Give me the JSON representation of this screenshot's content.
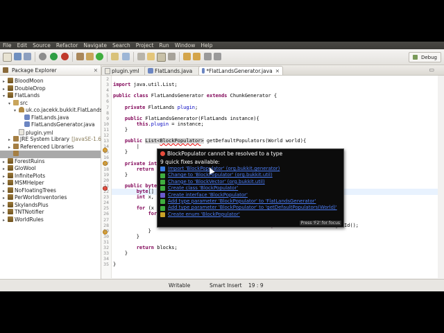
{
  "menu": [
    "File",
    "Edit",
    "Source",
    "Refactor",
    "Navigate",
    "Search",
    "Project",
    "Run",
    "Window",
    "Help"
  ],
  "toolbar": {
    "perspective_label": "Debug"
  },
  "explorer": {
    "tab_label": "Package Explorer",
    "items": [
      {
        "label": "BloodMoon",
        "depth": 0,
        "icon": "project-icon"
      },
      {
        "label": "DoubleDrop",
        "depth": 0,
        "icon": "project-icon"
      },
      {
        "label": "FlatLands",
        "depth": 0,
        "icon": "project-icon"
      },
      {
        "label": "src",
        "depth": 1,
        "icon": "source-folder-icon"
      },
      {
        "label": "uk.co.jacekk.bukkit.FlatLands",
        "depth": 2,
        "icon": "package-icon"
      },
      {
        "label": "FlatLands.java",
        "depth": 3,
        "icon": "java-file-icon"
      },
      {
        "label": "FlatLandsGenerator.java",
        "depth": 3,
        "icon": "java-file-icon"
      },
      {
        "label": "plugin.yml",
        "depth": 2,
        "icon": "yml-file-icon"
      },
      {
        "label": "JRE System Library",
        "decor": "[JavaSE-1.6]",
        "depth": 1,
        "icon": "library-icon"
      },
      {
        "label": "Referenced Libraries",
        "depth": 1,
        "icon": "library-icon"
      },
      {
        "label": "",
        "depth": 1,
        "icon": "jar-icon"
      },
      {
        "label": "ForestRuins",
        "depth": 0,
        "icon": "project-icon"
      },
      {
        "label": "GloWool",
        "depth": 0,
        "icon": "project-icon"
      },
      {
        "label": "InfinitePlots",
        "depth": 0,
        "icon": "project-icon"
      },
      {
        "label": "MSMHelper",
        "depth": 0,
        "icon": "project-icon"
      },
      {
        "label": "NoFloatingTrees",
        "depth": 0,
        "icon": "project-icon"
      },
      {
        "label": "PerWorldInventories",
        "depth": 0,
        "icon": "project-icon"
      },
      {
        "label": "SkylandsPlus",
        "depth": 0,
        "icon": "project-icon"
      },
      {
        "label": "TNTNotifier",
        "depth": 0,
        "icon": "project-icon"
      },
      {
        "label": "WorldRules",
        "depth": 0,
        "icon": "project-icon"
      }
    ]
  },
  "editor": {
    "tabs": [
      "plugin.yml",
      "FlatLands.java",
      "*FlatLandsGenerator.java"
    ],
    "lines": [
      {
        "n": "2",
        "text": ""
      },
      {
        "n": "3",
        "text": "import java.util.List;"
      },
      {
        "n": "4",
        "text": ""
      },
      {
        "n": "5",
        "text": "public class FlatLandsGenerator extends ChunkGenerator {"
      },
      {
        "n": "6",
        "text": ""
      },
      {
        "n": "7",
        "text": "    private FlatLands plugin;"
      },
      {
        "n": "8",
        "text": ""
      },
      {
        "n": "9",
        "text": "    public FlatLandsGenerator(FlatLands instance){"
      },
      {
        "n": "10",
        "text": "        this.plugin = instance;"
      },
      {
        "n": "11",
        "text": "    }"
      },
      {
        "n": "12",
        "text": ""
      },
      {
        "n": "13",
        "text": "    public List<BlockPopulator> getDefaultPopulators(World world){"
      },
      {
        "n": "14",
        "text": "        |"
      },
      {
        "n": "15",
        "text": "    }"
      },
      {
        "n": "16",
        "text": ""
      },
      {
        "n": "17",
        "text": "    private int"
      },
      {
        "n": "18",
        "text": "        return"
      },
      {
        "n": "19",
        "text": "    }"
      },
      {
        "n": "20",
        "text": ""
      },
      {
        "n": "21",
        "text": "    public byte[]"
      },
      {
        "n": "22",
        "text": "        byte[] b"
      },
      {
        "n": "23",
        "text": "        int x, y"
      },
      {
        "n": "24",
        "text": ""
      },
      {
        "n": "25",
        "text": "        for (x ="
      },
      {
        "n": "26",
        "text": "            for"
      },
      {
        "n": "27",
        "text": ""
      },
      {
        "n": "28",
        "text": "                blocks[this.coordsToInt(x, 0, z)] = (byte) Material.BEDROCK.getId();"
      },
      {
        "n": "29",
        "text": "            }"
      },
      {
        "n": "30",
        "text": "        }"
      },
      {
        "n": "31",
        "text": ""
      },
      {
        "n": "32",
        "text": "        return blocks;"
      },
      {
        "n": "33",
        "text": "    }"
      },
      {
        "n": "34",
        "text": ""
      },
      {
        "n": "35",
        "text": "}"
      }
    ]
  },
  "quickfix": {
    "title": "BlockPopulator cannot be resolved to a type",
    "subtitle": "9 quick fixes available:",
    "fixes": [
      {
        "label": "Import 'BlockPopulator' (org.bukkit.generator)",
        "icon": "import-icon",
        "color": "#3a7de0"
      },
      {
        "label": "Change to 'BlockPopulator' (org.bukkit.util)",
        "icon": "change-icon",
        "color": "#3fae3f"
      },
      {
        "label": "Change to 'BlockVector' (org.bukkit.util)",
        "icon": "change-icon",
        "color": "#3fae3f"
      },
      {
        "label": "Create class 'BlockPopulator'",
        "icon": "class-icon",
        "color": "#3fae3f"
      },
      {
        "label": "Create interface 'BlockPopulator'",
        "icon": "interface-icon",
        "color": "#6a5acd"
      },
      {
        "label": "Add type parameter 'BlockPopulator' to 'FlatLandsGenerator'",
        "icon": "type-param-icon",
        "color": "#3fae3f"
      },
      {
        "label": "Add type parameter 'BlockPopulator' to 'getDefaultPopulators(World)'",
        "icon": "type-param-icon",
        "color": "#3fae3f"
      },
      {
        "label": "Create enum 'BlockPopulator'",
        "icon": "enum-icon",
        "color": "#c9a227"
      }
    ],
    "footer": "Press 'F2' for focus"
  },
  "status": {
    "mode": "Writable",
    "insert": "Smart Insert",
    "position": "19 : 9"
  }
}
